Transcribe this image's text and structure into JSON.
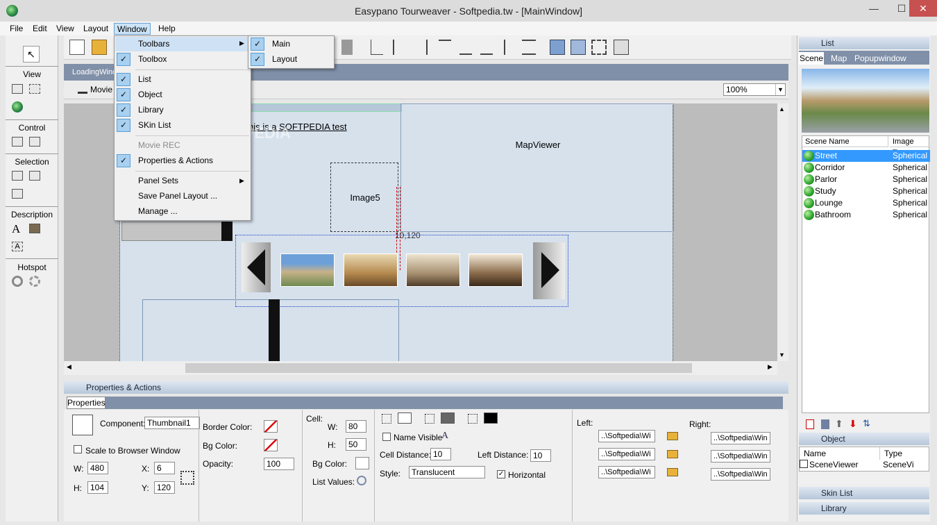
{
  "window": {
    "title": "Easypano Tourweaver - Softpedia.tw - [MainWindow]",
    "minimize": "—",
    "maximize": "☐",
    "close": "✕"
  },
  "menubar": {
    "items": [
      "File",
      "Edit",
      "View",
      "Layout",
      "Window",
      "Help"
    ]
  },
  "leftbar": {
    "sections": [
      "View",
      "Control",
      "Selection",
      "Description",
      "Hotspot"
    ]
  },
  "tabs": {
    "active": "LoadingWindow"
  },
  "subbar": {
    "movie": "Movie",
    "zoom": "100%"
  },
  "window_menu": {
    "items": [
      {
        "label": "Toolbars",
        "checked": false,
        "submenu": true
      },
      {
        "label": "Toolbox",
        "checked": true
      },
      {
        "label": "List",
        "checked": true
      },
      {
        "label": "Object",
        "checked": true
      },
      {
        "label": "Library",
        "checked": true
      },
      {
        "label": "SKin List",
        "checked": true
      },
      {
        "label": "Movie REC",
        "checked": false,
        "disabled": true
      },
      {
        "label": "Properties & Actions",
        "checked": true
      },
      {
        "label": "Panel Sets",
        "checked": false,
        "submenu": true
      },
      {
        "label": "Save Panel Layout ...",
        "checked": false
      },
      {
        "label": "Manage ...",
        "checked": false
      }
    ]
  },
  "toolbars_submenu": {
    "items": [
      "Main",
      "Layout"
    ]
  },
  "canvas": {
    "test_text": "his is a SOFTPEDIA test",
    "mapviewer": "MapViewer",
    "image5": "Image5",
    "coord": "10,120",
    "watermark": "SOFTPEDIA"
  },
  "properties": {
    "panel_title": "Properties & Actions",
    "tab": "Properties",
    "component_label": "Component:",
    "component": "Thumbnail1",
    "scale_label": "Scale to Browser Window",
    "w_label": "W:",
    "w": "480",
    "h_label": "H:",
    "h": "104",
    "x_label": "X:",
    "x": "6",
    "y_label": "Y:",
    "y": "120",
    "border_color": "Border Color:",
    "bg_color": "Bg Color:",
    "opacity_label": "Opacity:",
    "opacity": "100",
    "cell_label": "Cell:",
    "cell_w_label": "W:",
    "cell_w": "80",
    "cell_h_label": "H:",
    "cell_h": "50",
    "cell_bg": "Bg Color:",
    "list_values": "List Values:",
    "name_visible": "Name Visible",
    "cell_distance_label": "Cell Distance:",
    "cell_distance": "10",
    "left_distance_label": "Left Distance:",
    "left_distance": "10",
    "style_label": "Style:",
    "style": "Translucent",
    "horizontal": "Horizontal",
    "left_label": "Left:",
    "right_label": "Right:",
    "left_paths": [
      "..\\Softpedia\\Wi",
      "..\\Softpedia\\Wi",
      "..\\Softpedia\\Wi"
    ],
    "right_paths": [
      "..\\Softpedia\\Win",
      "..\\Softpedia\\Win",
      "..\\Softpedia\\Win"
    ]
  },
  "list_panel": {
    "title": "List",
    "tabs": [
      "Scene",
      "Map",
      "Popupwindow"
    ],
    "col_name": "Scene Name",
    "col_type": "Image Type",
    "rows": [
      [
        "Street",
        "Spherical"
      ],
      [
        "Corridor",
        "Spherical"
      ],
      [
        "Parlor",
        "Spherical"
      ],
      [
        "Study",
        "Spherical"
      ],
      [
        "Lounge",
        "Spherical"
      ],
      [
        "Bathroom",
        "Spherical"
      ]
    ]
  },
  "object_panel": {
    "title": "Object",
    "col_name": "Name",
    "col_type": "Type",
    "row_name": "SceneViewer",
    "row_type": "SceneVi"
  },
  "skin_list": {
    "title": "Skin List"
  },
  "library": {
    "title": "Library"
  }
}
